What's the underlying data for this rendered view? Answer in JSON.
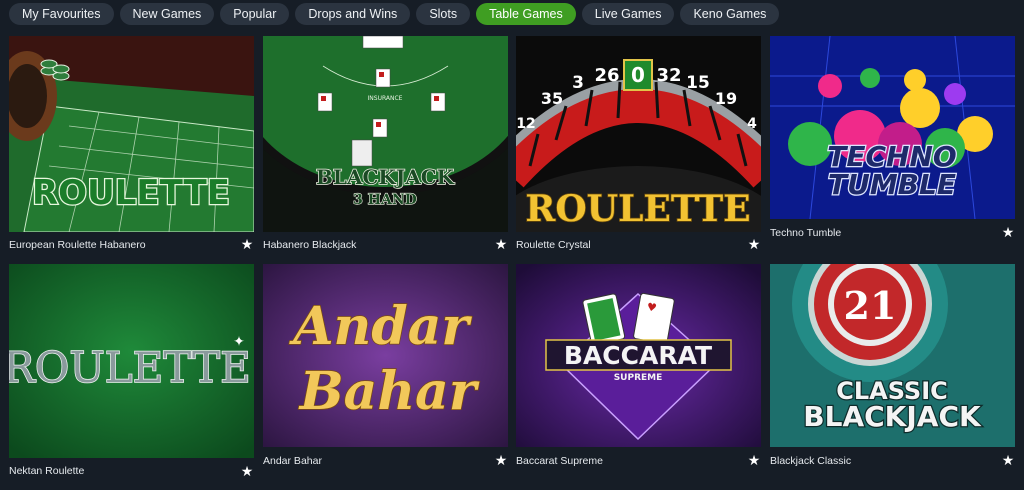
{
  "tabs": [
    {
      "label": "My Favourites",
      "active": false
    },
    {
      "label": "New Games",
      "active": false
    },
    {
      "label": "Popular",
      "active": false
    },
    {
      "label": "Drops and Wins",
      "active": false
    },
    {
      "label": "Slots",
      "active": false
    },
    {
      "label": "Table Games",
      "active": true
    },
    {
      "label": "Live Games",
      "active": false
    },
    {
      "label": "Keno Games",
      "active": false
    }
  ],
  "games": [
    {
      "name": "European Roulette Habanero",
      "art_text": "ROULETTE"
    },
    {
      "name": "Habanero Blackjack",
      "art_text": "BLACKJACK",
      "art_subtext": "3 HAND",
      "art_small": "INSURANCE"
    },
    {
      "name": "Roulette Crystal",
      "art_text": "ROULETTE",
      "wheel_numbers": [
        "12",
        "35",
        "3",
        "26",
        "0",
        "32",
        "15",
        "19",
        "4"
      ]
    },
    {
      "name": "Techno Tumble",
      "art_text": "TECHNO",
      "art_subtext": "TUMBLE"
    },
    {
      "name": "Nektan Roulette",
      "art_text": "ROULETTE"
    },
    {
      "name": "Andar Bahar",
      "art_text": "Andar",
      "art_subtext": "Bahar"
    },
    {
      "name": "Baccarat Supreme",
      "art_text": "BACCARAT",
      "art_subtext": "SUPREME"
    },
    {
      "name": "Blackjack Classic",
      "art_text": "CLASSIC",
      "art_subtext": "BLACKJACK",
      "art_number": "21"
    }
  ],
  "favourite_icon": "star-icon",
  "colors": {
    "background": "#161d26",
    "tab": "#2b3440",
    "tab_active": "#3f9e22",
    "felt_green": "#1f6b2c"
  }
}
